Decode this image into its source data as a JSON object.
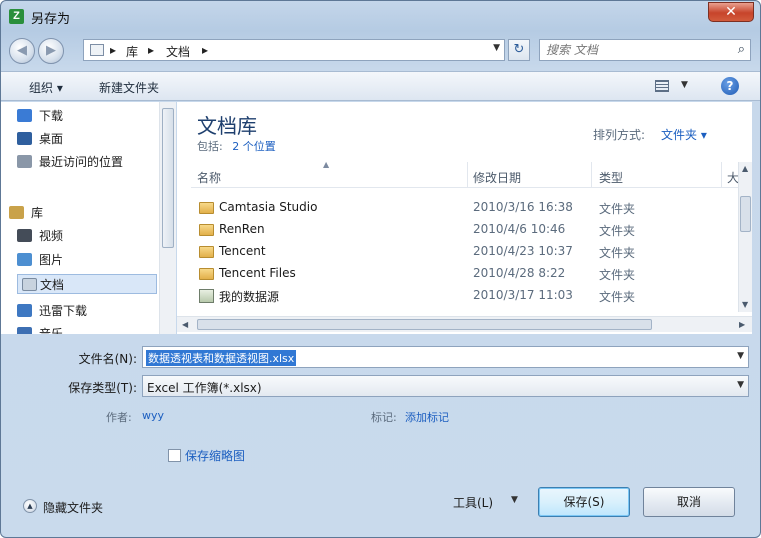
{
  "window": {
    "title": "另存为",
    "app_icon": "Z",
    "close_glyph": "✕"
  },
  "address_bar": {
    "segments": [
      "库",
      "文档"
    ],
    "separator": "▸",
    "search_placeholder": "搜索 文档"
  },
  "toolbar": {
    "organize_label": "组织 ▾",
    "new_folder_label": "新建文件夹"
  },
  "sidebar": {
    "items": [
      {
        "label": "下载",
        "icon": "download-icon",
        "color": "#3a7bd5"
      },
      {
        "label": "桌面",
        "icon": "desktop-icon",
        "color": "#2f5f9e"
      },
      {
        "label": "最近访问的位置",
        "icon": "recent-places-icon",
        "color": "#8a97a8"
      },
      {
        "label": "库",
        "icon": "library-icon",
        "color": "#c9a24a"
      },
      {
        "label": "视频",
        "icon": "video-icon",
        "color": "#444c58"
      },
      {
        "label": "图片",
        "icon": "pictures-icon",
        "color": "#4d8fd1"
      },
      {
        "label": "文档",
        "icon": "documents-icon",
        "color": "#c8d3df",
        "selected": true
      },
      {
        "label": "迅雷下载",
        "icon": "thunder-download-icon",
        "color": "#3e78c2"
      },
      {
        "label": "音乐",
        "icon": "music-icon",
        "color": "#3d6fb3"
      }
    ]
  },
  "library": {
    "title": "文档库",
    "includes_label": "包括:",
    "includes_link": "2 个位置",
    "arrange_label": "排列方式:",
    "arrange_value": "文件夹 ▾"
  },
  "file_list": {
    "columns": [
      "名称",
      "修改日期",
      "类型",
      "大"
    ],
    "rows": [
      {
        "name": "Camtasia Studio",
        "date": "2010/3/16 16:38",
        "type": "文件夹",
        "icon": "folder-icon"
      },
      {
        "name": "RenRen",
        "date": "2010/4/6 10:46",
        "type": "文件夹",
        "icon": "folder-icon"
      },
      {
        "name": "Tencent",
        "date": "2010/4/23 10:37",
        "type": "文件夹",
        "icon": "folder-icon"
      },
      {
        "name": "Tencent Files",
        "date": "2010/4/28 8:22",
        "type": "文件夹",
        "icon": "folder-icon"
      },
      {
        "name": "我的数据源",
        "date": "2010/3/17 11:03",
        "type": "文件夹",
        "icon": "data-source-icon"
      }
    ]
  },
  "form": {
    "filename_label": "文件名(N):",
    "filename_value": "数据透视表和数据透视图.xlsx",
    "savetype_label": "保存类型(T):",
    "savetype_value": "Excel 工作簿(*.xlsx)",
    "author_label": "作者:",
    "author_value": "wyy",
    "tags_label": "标记:",
    "tags_value": "添加标记",
    "thumbnail_label": "保存缩略图"
  },
  "footer": {
    "hide_folders_label": "隐藏文件夹",
    "tools_label": "工具(L)",
    "save_label": "保存(S)",
    "cancel_label": "取消"
  }
}
